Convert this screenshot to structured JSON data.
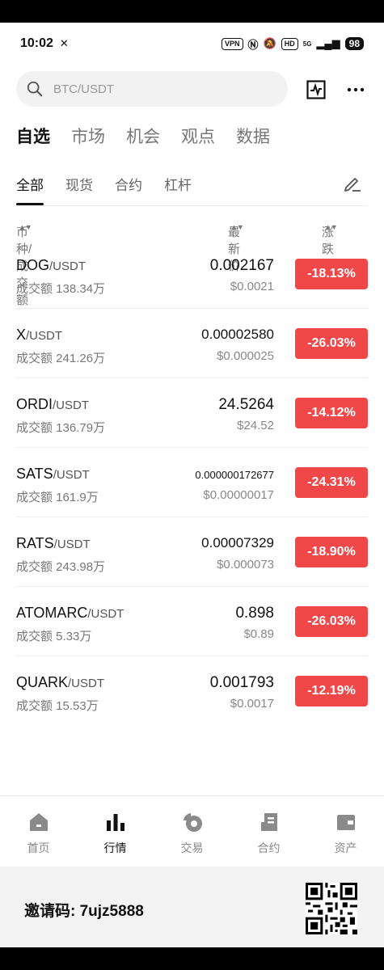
{
  "status": {
    "time": "10:02",
    "vpn": "VPN",
    "hd": "HD",
    "signal": "5G",
    "battery": "98"
  },
  "search": {
    "placeholder": "BTC/USDT"
  },
  "main_tabs": [
    {
      "label": "自选",
      "active": true
    },
    {
      "label": "市场",
      "active": false
    },
    {
      "label": "机会",
      "active": false
    },
    {
      "label": "观点",
      "active": false
    },
    {
      "label": "数据",
      "active": false
    }
  ],
  "sub_tabs": [
    {
      "label": "全部",
      "active": true
    },
    {
      "label": "现货",
      "active": false
    },
    {
      "label": "合约",
      "active": false
    },
    {
      "label": "杠杆",
      "active": false
    }
  ],
  "columns": {
    "pair": "币种/成交额",
    "price": "最新价",
    "change": "涨跌幅"
  },
  "rows": [
    {
      "base": "DOG",
      "quote": "/USDT",
      "volume": "成交额 138.34万",
      "price": "0.002167",
      "usd": "$0.0021",
      "change": "-18.13%"
    },
    {
      "base": "X",
      "quote": "/USDT",
      "volume": "成交额 241.26万",
      "price": "0.00002580",
      "usd": "$0.000025",
      "change": "-26.03%"
    },
    {
      "base": "ORDI",
      "quote": "/USDT",
      "volume": "成交额 136.79万",
      "price": "24.5264",
      "usd": "$24.52",
      "change": "-14.12%"
    },
    {
      "base": "SATS",
      "quote": "/USDT",
      "volume": "成交额 161.9万",
      "price": "0.000000172677",
      "usd": "$0.00000017",
      "change": "-24.31%"
    },
    {
      "base": "RATS",
      "quote": "/USDT",
      "volume": "成交额 243.98万",
      "price": "0.00007329",
      "usd": "$0.000073",
      "change": "-18.90%"
    },
    {
      "base": "ATOMARC",
      "quote": "/USDT",
      "volume": "成交额 5.33万",
      "price": "0.898",
      "usd": "$0.89",
      "change": "-26.03%"
    },
    {
      "base": "QUARK",
      "quote": "/USDT",
      "volume": "成交额 15.53万",
      "price": "0.001793",
      "usd": "$0.0017",
      "change": "-12.19%"
    }
  ],
  "nav": [
    {
      "label": "首页",
      "icon": "home-icon"
    },
    {
      "label": "行情",
      "icon": "market-bars-icon",
      "active": true
    },
    {
      "label": "交易",
      "icon": "trade-icon"
    },
    {
      "label": "合约",
      "icon": "contract-icon"
    },
    {
      "label": "资产",
      "icon": "wallet-icon"
    }
  ],
  "invite": {
    "text": "邀请码: 7ujz5888"
  },
  "colors": {
    "down": "#f04848",
    "accent": "#111111"
  }
}
